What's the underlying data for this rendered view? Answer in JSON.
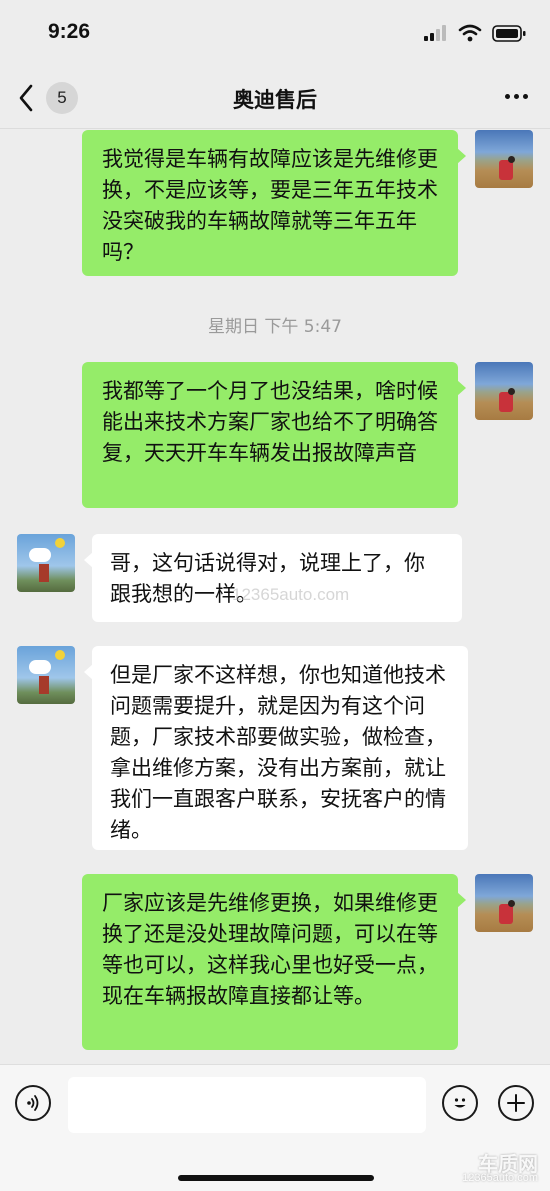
{
  "status_bar": {
    "time": "9:26"
  },
  "header": {
    "unread_count": "5",
    "title": "奥迪售后"
  },
  "messages": [
    {
      "side": "right",
      "text": "我觉得是车辆有故障应该是先维修更换，不是应该等，要是三年五年技术没突破我的车辆故障就等三年五年吗？"
    },
    {
      "side": "right",
      "text": "我都等了一个月了也没结果，啥时候能出来技术方案厂家也给不了明确答复，天天开车车辆发出报故障声音"
    },
    {
      "side": "left",
      "text": "哥，这句话说得对，说理上了，你跟我想的一样。"
    },
    {
      "side": "left",
      "text": "但是厂家不这样想，你也知道他技术问题需要提升，就是因为有这个问题，厂家技术部要做实验，做检查，拿出维修方案，没有出方案前，就让我们一直跟客户联系，安抚客户的情绪。"
    },
    {
      "side": "right",
      "text": "厂家应该是先维修更换，如果维修更换了还是没处理故障问题，可以在等等也可以，这样我心里也好受一点，现在车辆报故障直接都让等。"
    }
  ],
  "timestamp": "星期日 下午 5:47",
  "input": {
    "value": "",
    "placeholder": ""
  },
  "watermarks": {
    "middle": "12365auto.com",
    "logo": "车质网",
    "url": "12365auto.com"
  },
  "colors": {
    "sent_bubble": "#95ec69",
    "received_bubble": "#ffffff",
    "background": "#ededed"
  }
}
